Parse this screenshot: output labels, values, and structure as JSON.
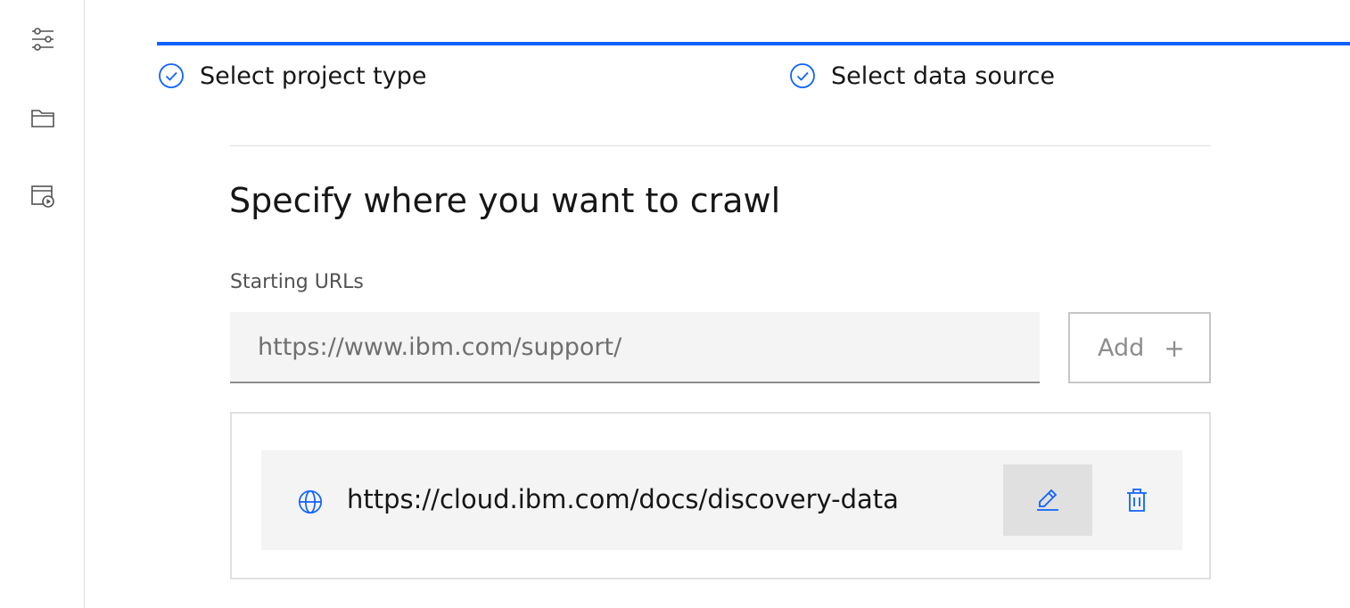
{
  "sidebar": {
    "items": [
      {
        "icon": "settings-adjust-icon"
      },
      {
        "icon": "folder-icon"
      },
      {
        "icon": "deploy-icon"
      }
    ]
  },
  "progress": {
    "steps": [
      {
        "label": "Select project type",
        "status": "complete"
      },
      {
        "label": "Select data source",
        "status": "complete"
      }
    ],
    "accent": "#0f62fe"
  },
  "main": {
    "heading": "Specify where you want to crawl",
    "starting_urls_label": "Starting URLs",
    "url_input": {
      "value": "",
      "placeholder": "https://www.ibm.com/support/"
    },
    "add_button": {
      "label": "Add",
      "icon": "+"
    },
    "urls": [
      {
        "icon": "globe-icon",
        "url": "https://cloud.ibm.com/docs/discovery-data"
      }
    ]
  }
}
